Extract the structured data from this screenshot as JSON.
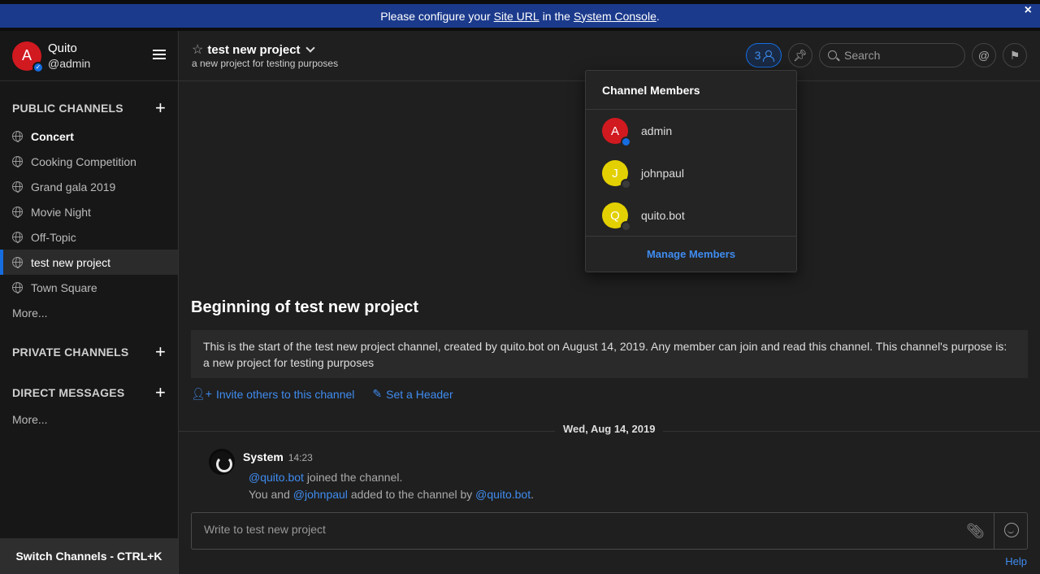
{
  "banner": {
    "prefix": "Please configure your",
    "site_url_link": "Site URL",
    "middle": "in the",
    "console_link": "System Console",
    "suffix": ".",
    "close_icon": "×"
  },
  "team": {
    "avatar_letter": "A",
    "name": "Quito",
    "username": "@admin"
  },
  "sidebar": {
    "public_header": "PUBLIC CHANNELS",
    "public_channels": [
      {
        "label": "Concert"
      },
      {
        "label": "Cooking Competition"
      },
      {
        "label": "Grand gala 2019"
      },
      {
        "label": "Movie Night"
      },
      {
        "label": "Off-Topic"
      },
      {
        "label": "test new project"
      },
      {
        "label": "Town Square"
      }
    ],
    "public_more": "More...",
    "private_header": "PRIVATE CHANNELS",
    "direct_header": "DIRECT MESSAGES",
    "direct_more": "More...",
    "switch_channels": "Switch Channels - CTRL+K"
  },
  "header": {
    "channel_name": "test new project",
    "purpose": "a new project for testing purposes",
    "member_count": "3",
    "search_placeholder": "Search",
    "at_icon": "@"
  },
  "members_popover": {
    "title": "Channel Members",
    "members": [
      {
        "letter": "A",
        "name": "admin",
        "avatar_color": "#d11920",
        "status_color": "#166de0"
      },
      {
        "letter": "J",
        "name": "johnpaul",
        "avatar_color": "#e3d000",
        "status_color": "#3a3a3a"
      },
      {
        "letter": "Q",
        "name": "quito.bot",
        "avatar_color": "#e3d000",
        "status_color": "#3a3a3a"
      }
    ],
    "manage": "Manage Members"
  },
  "intro": {
    "title": "Beginning of test new project",
    "description": "This is the start of the test new project channel, created by quito.bot on August 14, 2019. Any member can join and read this channel. This channel's purpose is: a new project for testing purposes",
    "invite_link": "Invite others to this channel",
    "header_link": "Set a Header"
  },
  "messages": {
    "date_separator": "Wed, Aug 14, 2019",
    "author": "System",
    "time": "14:23",
    "line1_mention": "@quito.bot",
    "line1_text": "joined the channel.",
    "line2_prefix": "You and",
    "line2_mention1": "@johnpaul",
    "line2_mid": "added to the channel",
    "line2_by": "by",
    "line2_mention2": "@quito.bot",
    "line2_end": "."
  },
  "composer": {
    "placeholder": "Write to test new project"
  },
  "help_link": "Help"
}
